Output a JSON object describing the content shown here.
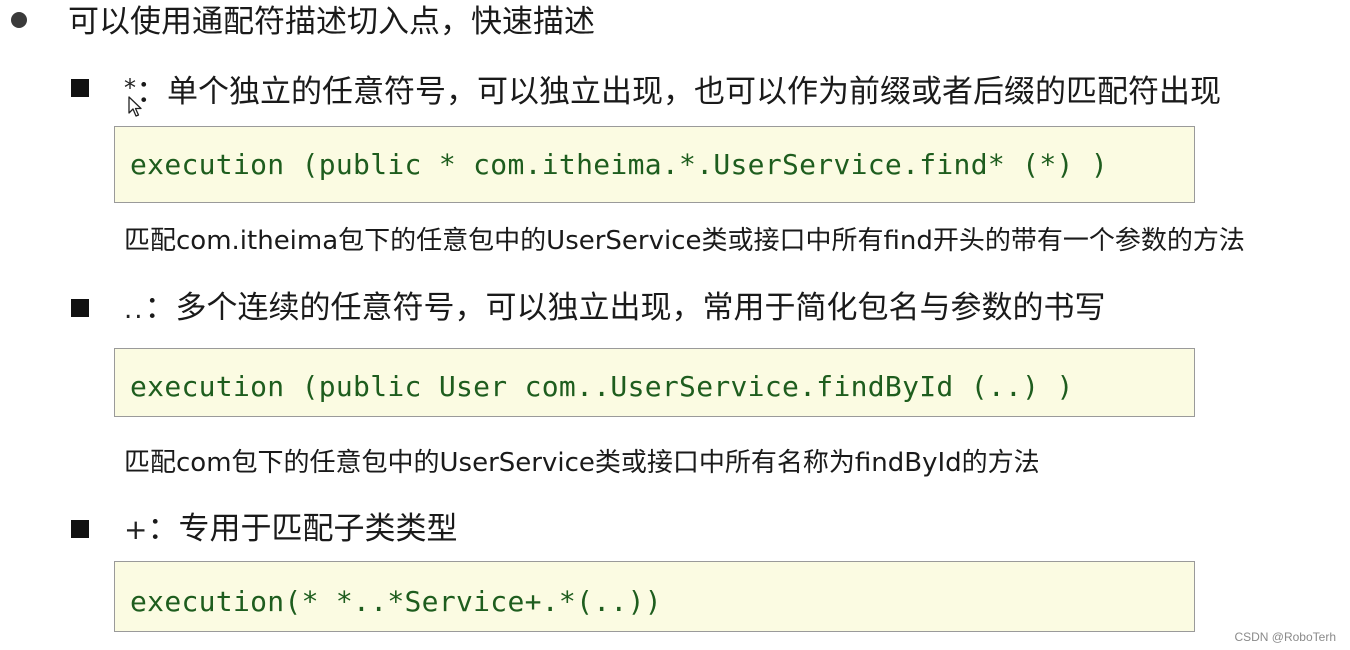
{
  "heading": {
    "text": "可以使用通配符描述切入点，快速描述"
  },
  "sections": [
    {
      "symbol": "*",
      "description": "：单个独立的任意符号，可以独立出现，也可以作为前缀或者后缀的匹配符出现",
      "code": "execution (public * com.itheima.*.UserService.find* (*) )",
      "explanation": "匹配com.itheima包下的任意包中的UserService类或接口中所有find开头的带有一个参数的方法"
    },
    {
      "symbol": "..",
      "description": "：多个连续的任意符号，可以独立出现，常用于简化包名与参数的书写",
      "code": "execution (public User com..UserService.findById (..) )",
      "explanation": "匹配com包下的任意包中的UserService类或接口中所有名称为findById的方法"
    },
    {
      "symbol": "+",
      "description": "：专用于匹配子类类型",
      "code": "execution(* *..*Service+.*(..))"
    }
  ],
  "watermark": "CSDN @RoboTerh",
  "colors": {
    "code_text": "#1e5d1e",
    "code_background": "#fbfbe2",
    "code_border": "#9a9a9a"
  },
  "icons": [
    "bullet-circle-icon",
    "bullet-square-icon",
    "mouse-cursor-icon"
  ]
}
